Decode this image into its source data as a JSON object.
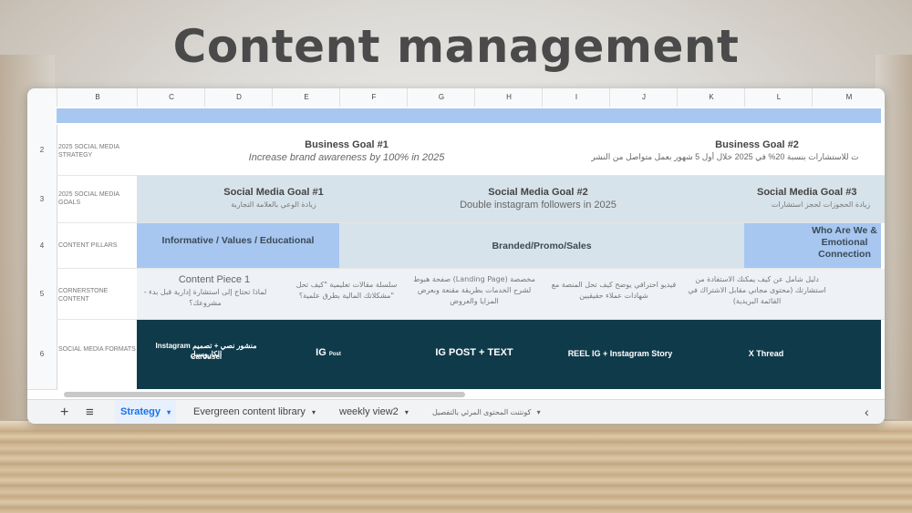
{
  "title": "Content management",
  "columns": [
    "B",
    "C",
    "D",
    "E",
    "F",
    "G",
    "H",
    "I",
    "J",
    "K",
    "L",
    "M"
  ],
  "rows": {
    "r2": {
      "num": "2",
      "label": "2025 SOCIAL MEDIA STRATEGY",
      "goal1_title": "Business Goal #1",
      "goal1_sub": "Increase brand awareness by 100% in 2025",
      "goal2_title": "Business Goal #2",
      "goal2_sub": "ت للاستشارات بنسبة 20% في 2025 خلال أول 5 شهور بعمل متواصل من النشر"
    },
    "r3": {
      "num": "3",
      "label": "2025 SOCIAL MEDIA GOALS",
      "g1_title": "Social Media Goal #1",
      "g1_sub": "زيادة الوعي بالعلامة التجارية",
      "g2_title": "Social Media Goal #2",
      "g2_sub": "Double instagram followers in 2025",
      "g3_title": "Social Media Goal #3",
      "g3_sub": "زيادة الحجوزات لحجز استشارات"
    },
    "r4": {
      "num": "4",
      "label": "CONTENT PILLARS",
      "p1": "Informative / Values / Educational",
      "p2": "Branded/Promo/Sales",
      "p3": "Who Are We & Emotional Connection"
    },
    "r5": {
      "num": "5",
      "label": "CORNERSTONE CONTENT",
      "c1a": "Content Piece 1",
      "c1b": "- لماذا تحتاج إلى استشارة إدارية قبل بدء مشروعك؟",
      "c2": "سلسلة مقالات تعليمية \"كيف تحل مشكلاتك المالية بطرق علمية؟\"",
      "c3": "صفحة هبوط (Landing Page) مخصصة لشرح الخدمات بطريقة مقنعة وبعرض المزايا والعروض",
      "c4": "فيديو احترافي يوضح كيف تحل المنصة مع شهادات عملاء حقيقيين",
      "c5": "دليل شامل عن كيف يمكنك الاستفادة من استشارتك (محتوى مجاني مقابل الاشتراك في القائمة البريدية)"
    },
    "r6": {
      "num": "6",
      "label": "SOCIAL MEDIA FORMATS",
      "f1a": "Instagram منشور نصي + تصميم الكاروسيل",
      "f1b": "Carousel",
      "f2": "IG",
      "f2s": "Post",
      "f3": "IG POST + TEXT",
      "f4": "REEL IG + Instagram Story",
      "f5": "X Thread"
    }
  },
  "tabs": [
    "Strategy",
    "Evergreen content library",
    "weekly view2",
    "كونتنت المحتوى المرئي بالتفصيل"
  ],
  "tab_arrow": "▾",
  "add_symbol": "+",
  "menu_symbol": "≡",
  "nav_symbol": "‹"
}
